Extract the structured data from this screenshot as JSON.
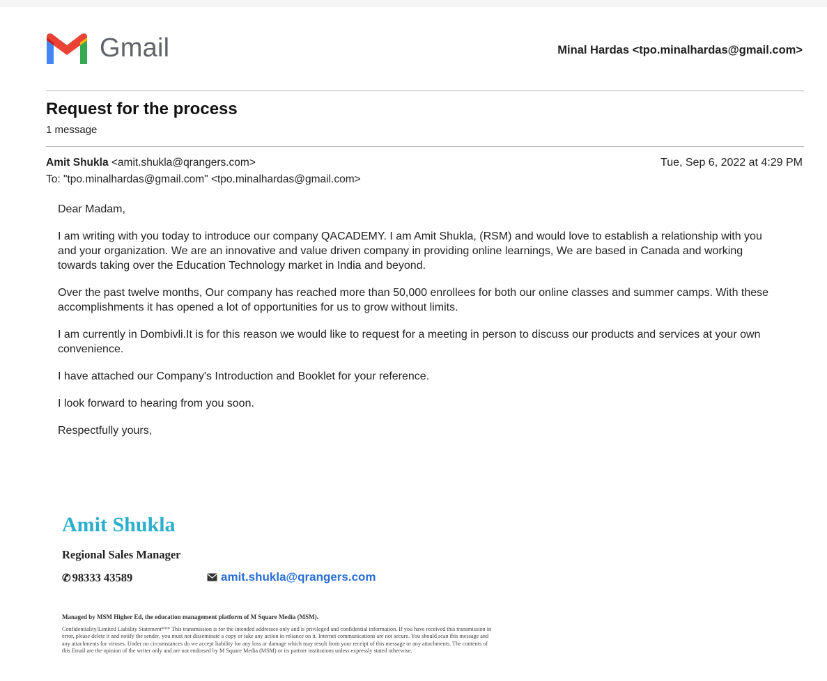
{
  "header": {
    "logo_text": "Gmail",
    "account": "Minal Hardas <tpo.minalhardas@gmail.com>",
    "logo_colors": {
      "red": "#ea4335",
      "blue": "#4285f4",
      "green": "#34a853",
      "yellow": "#fbbc04"
    }
  },
  "thread": {
    "subject": "Request for the process",
    "count": "1 message"
  },
  "message": {
    "sender_name": "Amit Shukla",
    "sender_email": " <amit.shukla@qrangers.com>",
    "to": "To: \"tpo.minalhardas@gmail.com\" <tpo.minalhardas@gmail.com>",
    "date": "Tue, Sep 6, 2022 at 4:29 PM",
    "paragraphs": [
      "Dear Madam,",
      "I am writing with you today to introduce our company QACADEMY. I am Amit Shukla, (RSM) and would love to establish a relationship with you and your organization. We are an innovative and value driven company in providing online learnings, We are based in Canada and working towards taking over the Education Technology market in India and beyond.",
      "Over the past twelve months, Our company has reached more than 50,000 enrollees for both our online classes and summer camps. With these accomplishments it has opened a lot of opportunities for us to grow without limits.",
      "I am currently in Dombivli.It is for this reason we would like to request for a meeting in person to discuss our products and services at your own convenience.",
      "I have attached our Company's Introduction and Booklet for your reference.",
      "I look forward to hearing from you soon.",
      "Respectfully yours,"
    ]
  },
  "signature": {
    "name": "Amit Shukla",
    "title": "Regional Sales Manager",
    "phone": "98333 43589",
    "email": "amit.shukla@qrangers.com",
    "name_color": "#2aaecb",
    "link_color": "#2b6fd6"
  },
  "footer": {
    "managed": "Managed by MSM Higher Ed, the education management platform of M Square Media (MSM).",
    "disclaimer": "Confidentiality/Limited Liability Statement*** This transmission is for the intended addressee only and is privileged and confidential information. If you have received this transmission in error, please delete it and notify the sender, you must not disseminate a copy or take any action in reliance on it. Internet communications are not secure. You should scan this message and any attachments for viruses. Under no circumstances do we accept liability for any loss or damage which may result from your receipt of this message or any attachments. The contents of this Email are the opinion of the writer only and are not endorsed by M Square Media (MSM) or its partner institutions unless expressly stated otherwise."
  }
}
